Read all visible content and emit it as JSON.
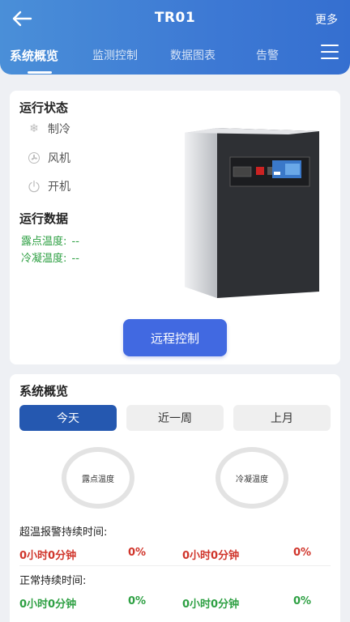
{
  "header": {
    "title": "TR01",
    "more_label": "更多"
  },
  "tabs": [
    {
      "label": "系统概览",
      "active": true
    },
    {
      "label": "监测控制",
      "active": false
    },
    {
      "label": "数据图表",
      "active": false
    },
    {
      "label": "告警",
      "active": false
    }
  ],
  "status_section": {
    "title": "运行状态",
    "items": [
      {
        "label": "制冷",
        "icon": "snowflake-icon"
      },
      {
        "label": "风机",
        "icon": "fan-icon"
      },
      {
        "label": "开机",
        "icon": "power-icon"
      }
    ]
  },
  "data_section": {
    "title": "运行数据",
    "dew_point_label": "露点温度:",
    "dew_point_value": "--",
    "condense_label": "冷凝温度:",
    "condense_value": "--"
  },
  "remote_button": "远程控制",
  "overview": {
    "title": "系统概览",
    "periods": [
      {
        "label": "今天",
        "active": true
      },
      {
        "label": "近一周",
        "active": false
      },
      {
        "label": "上月",
        "active": false
      }
    ],
    "rings": [
      {
        "label": "露点温度"
      },
      {
        "label": "冷凝温度"
      }
    ],
    "over_temp": {
      "label": "超温报警持续时间:",
      "values": [
        "0小时0分钟",
        "0%",
        "0小时0分钟",
        "0%"
      ]
    },
    "normal": {
      "label": "正常持续时间:",
      "values": [
        "0小时0分钟",
        "0%",
        "0小时0分钟",
        "0%"
      ]
    }
  },
  "colors": {
    "header_blue": "#3d79d4",
    "button_blue": "#4169e1",
    "active_segment": "#2558b0",
    "alarm_red": "#d0352b",
    "ok_green": "#2ea043"
  }
}
